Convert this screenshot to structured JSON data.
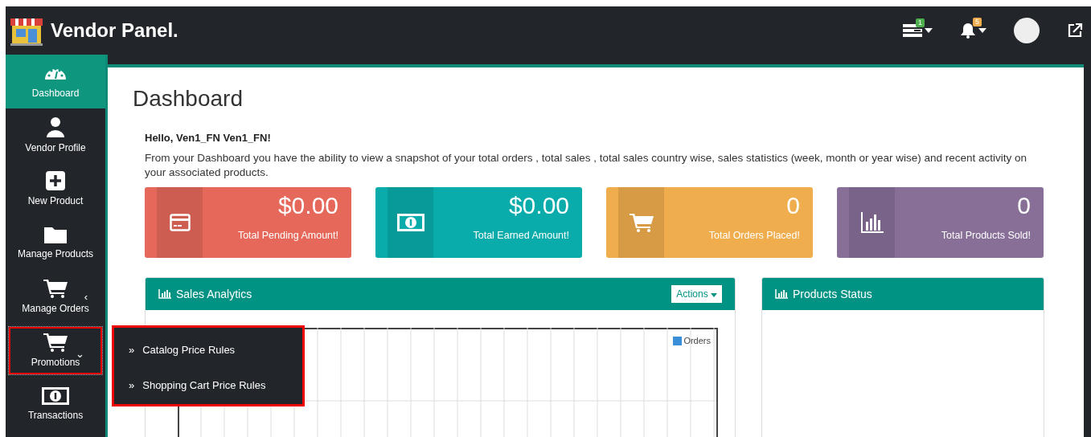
{
  "header": {
    "brand": "Vendor Panel.",
    "icons": [
      {
        "kind": "tasks",
        "badge": "1",
        "color": "#4cae4c"
      },
      {
        "kind": "bell",
        "badge": "5",
        "color": "#f0ad4e"
      },
      {
        "kind": "avatar"
      },
      {
        "kind": "external"
      }
    ]
  },
  "sidebar": {
    "items": [
      {
        "label": "Dashboard",
        "kind": "gauge",
        "selected": true,
        "highlighted": false
      },
      {
        "label": "Vendor Profile",
        "kind": "user",
        "selected": false,
        "highlighted": false
      },
      {
        "label": "New Product",
        "kind": "plus",
        "selected": false,
        "highlighted": false
      },
      {
        "label": "Manage Products",
        "kind": "folder",
        "selected": false,
        "highlighted": false
      },
      {
        "label": "Manage Orders",
        "kind": "cart",
        "caret": "‹",
        "selected": false,
        "highlighted": false
      },
      {
        "label": "Promotions",
        "kind": "cart",
        "caret": "⌄",
        "selected": false,
        "highlighted": true,
        "submenu": {
          "highlighted": true,
          "items": [
            {
              "marker": "»",
              "label": "Catalog Price Rules"
            },
            {
              "marker": "»",
              "label": "Shopping Cart Price Rules"
            }
          ]
        }
      },
      {
        "label": "Transactions",
        "kind": "money",
        "selected": false,
        "highlighted": false
      }
    ]
  },
  "page": {
    "title": "Dashboard",
    "greeting": "Hello, Ven1_FN Ven1_FN!",
    "intro": "From your Dashboard you have the ability to view a snapshot of your total orders , total sales , total sales country wise, sales statistics (week, month or year wise) and recent activity on your associated products."
  },
  "stats": [
    {
      "value": "$0.00",
      "label": "Total Pending Amount!",
      "color": "#e5685a",
      "kind": "card"
    },
    {
      "value": "$0.00",
      "label": "Total Earned Amount!",
      "color": "#0aabab",
      "kind": "money"
    },
    {
      "value": "0",
      "label": "Total Orders Placed!",
      "color": "#f0ad4e",
      "kind": "cart"
    },
    {
      "value": "0",
      "label": "Total Products Sold!",
      "color": "#886f98",
      "kind": "bars"
    }
  ],
  "panels": [
    {
      "title": "Sales Analytics",
      "action": "Actions",
      "legend": "Orders"
    },
    {
      "title": "Products Status"
    }
  ]
}
